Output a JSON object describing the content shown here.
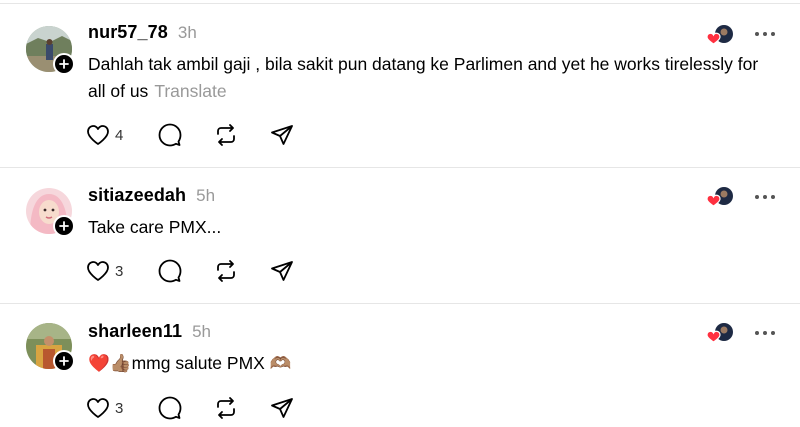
{
  "posts": [
    {
      "username": "nur57_78",
      "time": "3h",
      "text": "Dahlah tak ambil gaji , bila sakit pun datang ke Parlimen and yet he works tirelessly for all of us",
      "translate_label": "Translate",
      "like_count": "4",
      "avatar_icon": "user-photo-landscape"
    },
    {
      "username": "sitiazeedah",
      "time": "5h",
      "text": "Take care PMX...",
      "like_count": "3",
      "avatar_icon": "user-photo-hijab"
    },
    {
      "username": "sharleen11",
      "time": "5h",
      "text_emoji_prefix": "❤️👍🏽",
      "text": "mmg salute PMX",
      "text_emoji_suffix": "🫶🏽",
      "like_count": "3",
      "avatar_icon": "user-photo-outdoor"
    }
  ],
  "colors": {
    "secondary_text": "#999999",
    "divider": "#e6e6e6",
    "heart_red": "#ff3040"
  }
}
